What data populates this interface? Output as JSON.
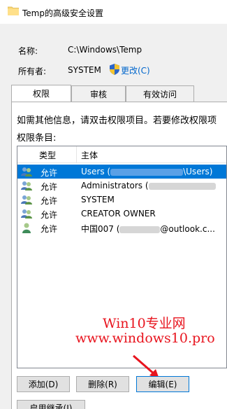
{
  "window": {
    "title": "Temp的高级安全设置"
  },
  "fields": {
    "name_label": "名称:",
    "name_value": "C:\\Windows\\Temp",
    "owner_label": "所有者:",
    "owner_value": "SYSTEM",
    "change_link": "更改(C)"
  },
  "tabs": [
    {
      "label": "权限",
      "active": true
    },
    {
      "label": "审核",
      "active": false
    },
    {
      "label": "有效访问",
      "active": false
    }
  ],
  "info_text": "如需其他信息，请双击权限项目。若要修改权限项",
  "entries_label": "权限条目:",
  "list": {
    "columns": [
      "类型",
      "主体"
    ],
    "rows": [
      {
        "type": "允许",
        "principal_prefix": "Users (",
        "principal_suffix": "\\Users)",
        "icon": "users-group-icon",
        "selected": true
      },
      {
        "type": "允许",
        "principal_prefix": "Administrators (",
        "principal_suffix": "",
        "icon": "users-group-icon",
        "selected": false
      },
      {
        "type": "允许",
        "principal_prefix": "SYSTEM",
        "principal_suffix": "",
        "icon": "users-group-icon",
        "selected": false
      },
      {
        "type": "允许",
        "principal_prefix": "CREATOR OWNER",
        "principal_suffix": "",
        "icon": "users-group-icon",
        "selected": false
      },
      {
        "type": "允许",
        "principal_prefix": "中国007 (",
        "principal_suffix": "@outlook.c...",
        "icon": "user-icon",
        "selected": false
      }
    ]
  },
  "watermark": {
    "line1": "Win10专业网",
    "line2": "www.windows10.pro",
    "color": "#e8141e"
  },
  "buttons": {
    "add": "添加(D)",
    "remove": "删除(R)",
    "edit": "编辑(E)",
    "inheritance": "启用继承(I)"
  },
  "colors": {
    "selection": "#0078d7",
    "link": "#0066cc"
  }
}
